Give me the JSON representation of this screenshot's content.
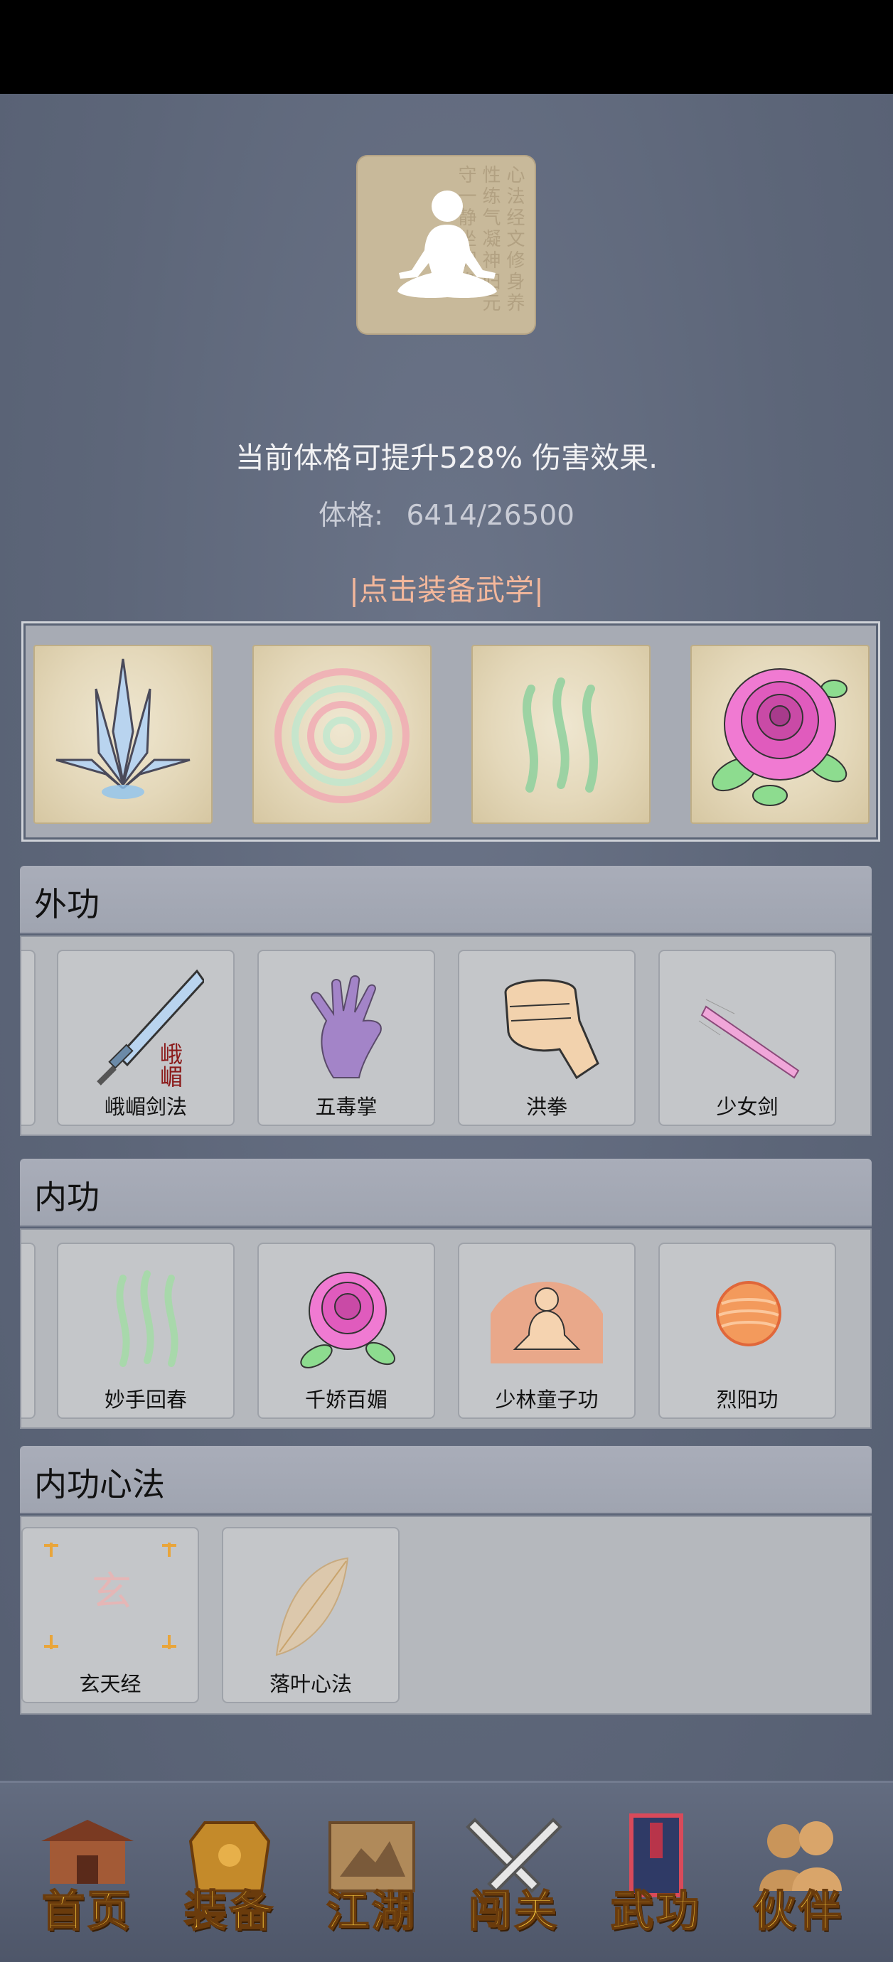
{
  "header": {
    "boost_text": "当前体格可提升528% 伤害效果.",
    "physique_label": "体格:",
    "physique_value": "6414/26500",
    "equip_link": "|点击装备武学|"
  },
  "equipped_slots": [
    {
      "icon": "crystal-blades-icon"
    },
    {
      "icon": "swirl-icon"
    },
    {
      "icon": "green-waves-icon"
    },
    {
      "icon": "rose-icon"
    }
  ],
  "sections": {
    "outer": {
      "title": "外功",
      "items": [
        {
          "label": "峨嵋剑法",
          "icon": "sword-icon",
          "icon_text": "峨嵋"
        },
        {
          "label": "五毒掌",
          "icon": "purple-palm-icon"
        },
        {
          "label": "洪拳",
          "icon": "fist-icon"
        },
        {
          "label": "少女剑",
          "icon": "pink-blade-icon"
        }
      ]
    },
    "inner": {
      "title": "内功",
      "items": [
        {
          "label": "妙手回春",
          "icon": "green-waves-icon"
        },
        {
          "label": "千娇百媚",
          "icon": "rose-icon"
        },
        {
          "label": "少林童子功",
          "icon": "meditating-monk-icon"
        },
        {
          "label": "烈阳功",
          "icon": "fire-orb-icon"
        }
      ]
    },
    "mind": {
      "title": "内功心法",
      "items": [
        {
          "label": "玄天经",
          "icon": "xuan-scroll-icon",
          "icon_text": "玄"
        },
        {
          "label": "落叶心法",
          "icon": "leaf-icon"
        }
      ]
    }
  },
  "bottom_nav": [
    {
      "label": "首页",
      "icon": "pavilion-icon"
    },
    {
      "label": "装备",
      "icon": "armor-icon"
    },
    {
      "label": "江湖",
      "icon": "map-scroll-icon"
    },
    {
      "label": "闯关",
      "icon": "crossed-swords-icon"
    },
    {
      "label": "武功",
      "icon": "book-icon"
    },
    {
      "label": "伙伴",
      "icon": "companions-icon"
    }
  ],
  "colors": {
    "background": "#5b6478",
    "accent_link": "#f3b79b",
    "nav_text": "#f2c23b"
  }
}
